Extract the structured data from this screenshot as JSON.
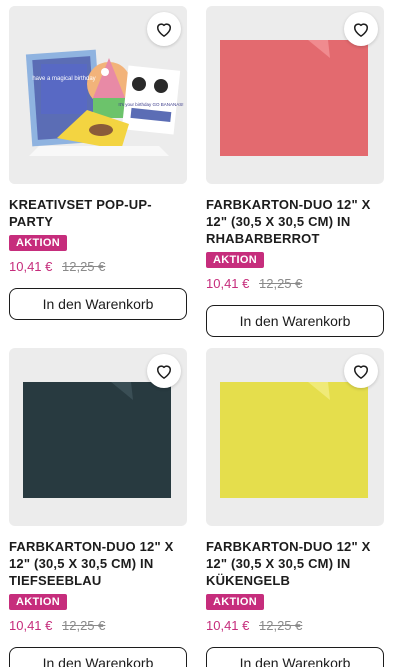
{
  "products": [
    {
      "title": "KREATIVSET POP-UP-PARTY",
      "badge": "AKTION",
      "price": "10,41 €",
      "old_price": "12,25 €",
      "cart_label": "In den Warenkorb",
      "image": {
        "type": "kit",
        "card_text_1": "have a magical birthday",
        "card_text_2": "It's your birthday GO BANANAS!"
      }
    },
    {
      "title": "FARBKARTON-DUO 12\" X 12\" (30,5 X 30,5 CM) IN RHABARBERROT",
      "badge": "AKTION",
      "price": "10,41 €",
      "old_price": "12,25 €",
      "cart_label": "In den Warenkorb",
      "image": {
        "type": "paper",
        "color": "#e36a6f",
        "fold_color": "#f08b8f"
      }
    },
    {
      "title": "FARBKARTON-DUO 12\" X 12\" (30,5 X 30,5 CM) IN TIEFSEEBLAU",
      "badge": "AKTION",
      "price": "10,41 €",
      "old_price": "12,25 €",
      "cart_label": "In den Warenkorb",
      "image": {
        "type": "paper",
        "color": "#283a40",
        "fold_color": "#3a4e55"
      }
    },
    {
      "title": "FARBKARTON-DUO 12\" X 12\" (30,5 X 30,5 CM) IN KÜKENGELB",
      "badge": "AKTION",
      "price": "10,41 €",
      "old_price": "12,25 €",
      "cart_label": "In den Warenkorb",
      "image": {
        "type": "paper",
        "color": "#e5de4c",
        "fold_color": "#f0ea78"
      }
    }
  ],
  "icons": {
    "favorite": "heart-outline-icon"
  },
  "colors": {
    "accent": "#c62d7c",
    "text": "#1c1c1c",
    "strike": "#8a8a8a"
  }
}
